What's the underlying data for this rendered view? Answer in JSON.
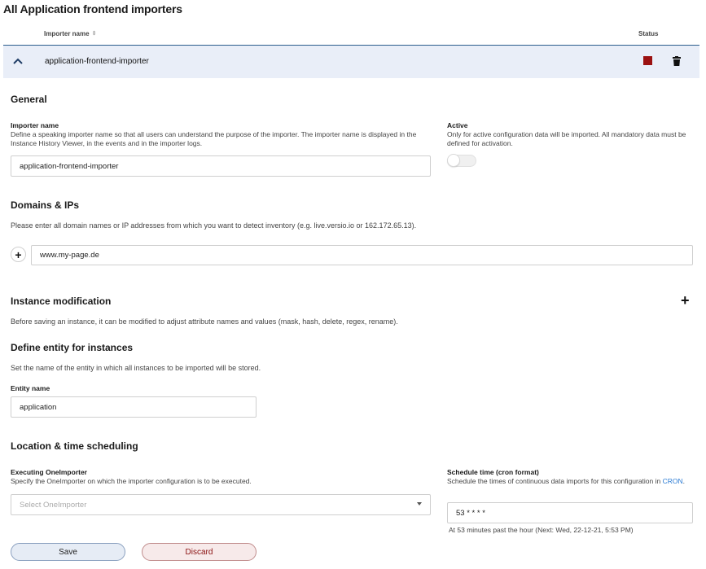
{
  "page": {
    "title": "All Application frontend importers"
  },
  "table": {
    "col_importer_name": "Importer name",
    "col_status": "Status",
    "row": {
      "name": "application-frontend-importer",
      "status_color": "#9b1111"
    }
  },
  "general": {
    "title": "General",
    "importer_name_label": "Importer name",
    "importer_name_desc": "Define a speaking importer name so that all users can understand the purpose of the importer. The importer name is displayed in the Instance History Viewer, in the events and in the importer logs.",
    "importer_name_value": "application-frontend-importer",
    "active_label": "Active",
    "active_desc": "Only for active configuration data will be imported. All mandatory data must be defined for activation.",
    "active_state": false
  },
  "domains": {
    "title": "Domains & IPs",
    "desc": "Please enter all domain names or IP addresses from which you want to detect inventory (e.g. live.versio.io or 162.172.65.13).",
    "value": "www.my-page.de"
  },
  "instance_mod": {
    "title": "Instance modification",
    "desc": "Before saving an instance, it can be modified to adjust attribute names and values (mask, hash, delete, regex, rename)."
  },
  "entity": {
    "title": "Define entity for instances",
    "desc": "Set the name of the entity in which all instances to be imported will be stored.",
    "label": "Entity name",
    "value": "application"
  },
  "scheduling": {
    "title": "Location & time scheduling",
    "executing_label": "Executing OneImporter",
    "executing_desc": "Specify the OneImporter on which the importer configuration is to be executed.",
    "executing_placeholder": "Select OneImporter",
    "schedule_label": "Schedule time (cron format)",
    "schedule_desc": "Schedule the times of continuous data imports for this configuration in",
    "schedule_link": "CRON",
    "schedule_link_suffix": ".",
    "schedule_value": "53 * * * *",
    "schedule_hint": "At 53 minutes past the hour (Next: Wed, 22-12-21, 5:53 PM)"
  },
  "actions": {
    "save_label": "Save",
    "discard_label": "Discard"
  },
  "icons": {
    "collapse": "chevron-up-icon",
    "status": "stop-square-icon",
    "delete": "trash-icon",
    "add_domain": "plus-icon",
    "add_modification": "plus-icon",
    "dropdown": "caret-down-icon"
  }
}
